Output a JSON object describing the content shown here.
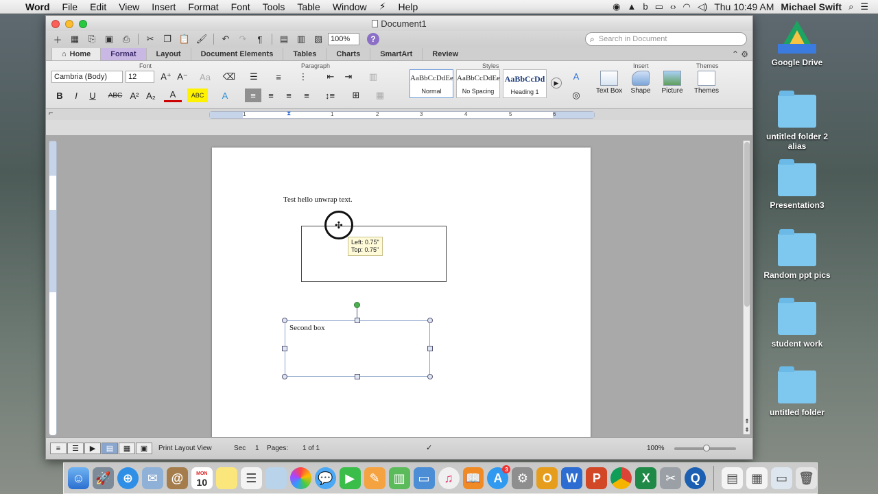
{
  "menubar": {
    "app": "Word",
    "items": [
      "File",
      "Edit",
      "View",
      "Insert",
      "Format",
      "Font",
      "Tools",
      "Table",
      "Window",
      "Help"
    ],
    "clock": "Thu 10:49 AM",
    "user": "Michael Swift"
  },
  "window": {
    "title": "Document1",
    "zoom": "100%",
    "search_placeholder": "Search in Document"
  },
  "tabs": [
    "Home",
    "Format",
    "Layout",
    "Document Elements",
    "Tables",
    "Charts",
    "SmartArt",
    "Review"
  ],
  "ribbon": {
    "groups": {
      "font": "Font",
      "paragraph": "Paragraph",
      "styles": "Styles",
      "insert": "Insert",
      "themes": "Themes"
    },
    "font_name": "Cambria (Body)",
    "font_size": "12",
    "styles": [
      {
        "sample": "AaBbCcDdEe",
        "label": "Normal"
      },
      {
        "sample": "AaBbCcDdEe",
        "label": "No Spacing"
      },
      {
        "sample": "AaBbCcDd",
        "label": "Heading 1"
      }
    ],
    "insert_items": [
      "Text Box",
      "Shape",
      "Picture"
    ],
    "themes_label": "Themes",
    "font_buttons": {
      "bold": "B",
      "italic": "I",
      "underline": "U",
      "strike": "ABC",
      "super": "A²",
      "sub": "A₂"
    }
  },
  "ruler_numbers": [
    "1",
    "1",
    "2",
    "3",
    "4",
    "5",
    "6"
  ],
  "document": {
    "body_text": "Test hello unwrap text.",
    "second_box_text": "Second box",
    "tooltip_left": "Left: 0.75\"",
    "tooltip_top": "Top: 0.75\""
  },
  "status": {
    "view": "Print Layout View",
    "sec_label": "Sec",
    "sec_value": "1",
    "pages_label": "Pages:",
    "pages_value": "1 of 1",
    "zoom": "100%"
  },
  "desktop": [
    {
      "label": "Google Drive",
      "type": "gdrive"
    },
    {
      "label": "untitled folder 2 alias",
      "type": "folder"
    },
    {
      "label": "Presentation3",
      "type": "folder"
    },
    {
      "label": "Random ppt pics",
      "type": "folder"
    },
    {
      "label": "student work",
      "type": "folder"
    },
    {
      "label": "untitled folder",
      "type": "folder"
    }
  ],
  "dock": {
    "calendar_day": "10",
    "calendar_month": "MON",
    "badge_appstore": "3",
    "apps": [
      "finder-icon",
      "launchpad-icon",
      "safari-icon",
      "mail-icon",
      "contacts-icon",
      "calendar-icon",
      "notes-icon",
      "reminders-icon",
      "preview-icon",
      "photos-icon",
      "messages-icon",
      "facetime-icon",
      "pages-icon",
      "numbers-icon",
      "keynote-icon",
      "itunes-icon",
      "ibooks-icon",
      "appstore-icon",
      "system-preferences-icon",
      "outlook-icon",
      "word-icon",
      "powerpoint-icon",
      "chrome-icon",
      "excel-icon",
      "utilities-icon",
      "quicktime-icon",
      "document-icon",
      "document2-icon",
      "screen-icon",
      "trash-icon"
    ]
  },
  "colors": {
    "format_tab": "#c9b8e4",
    "selection_handle": "#dfe6f3",
    "folder": "#7ec8f0"
  }
}
